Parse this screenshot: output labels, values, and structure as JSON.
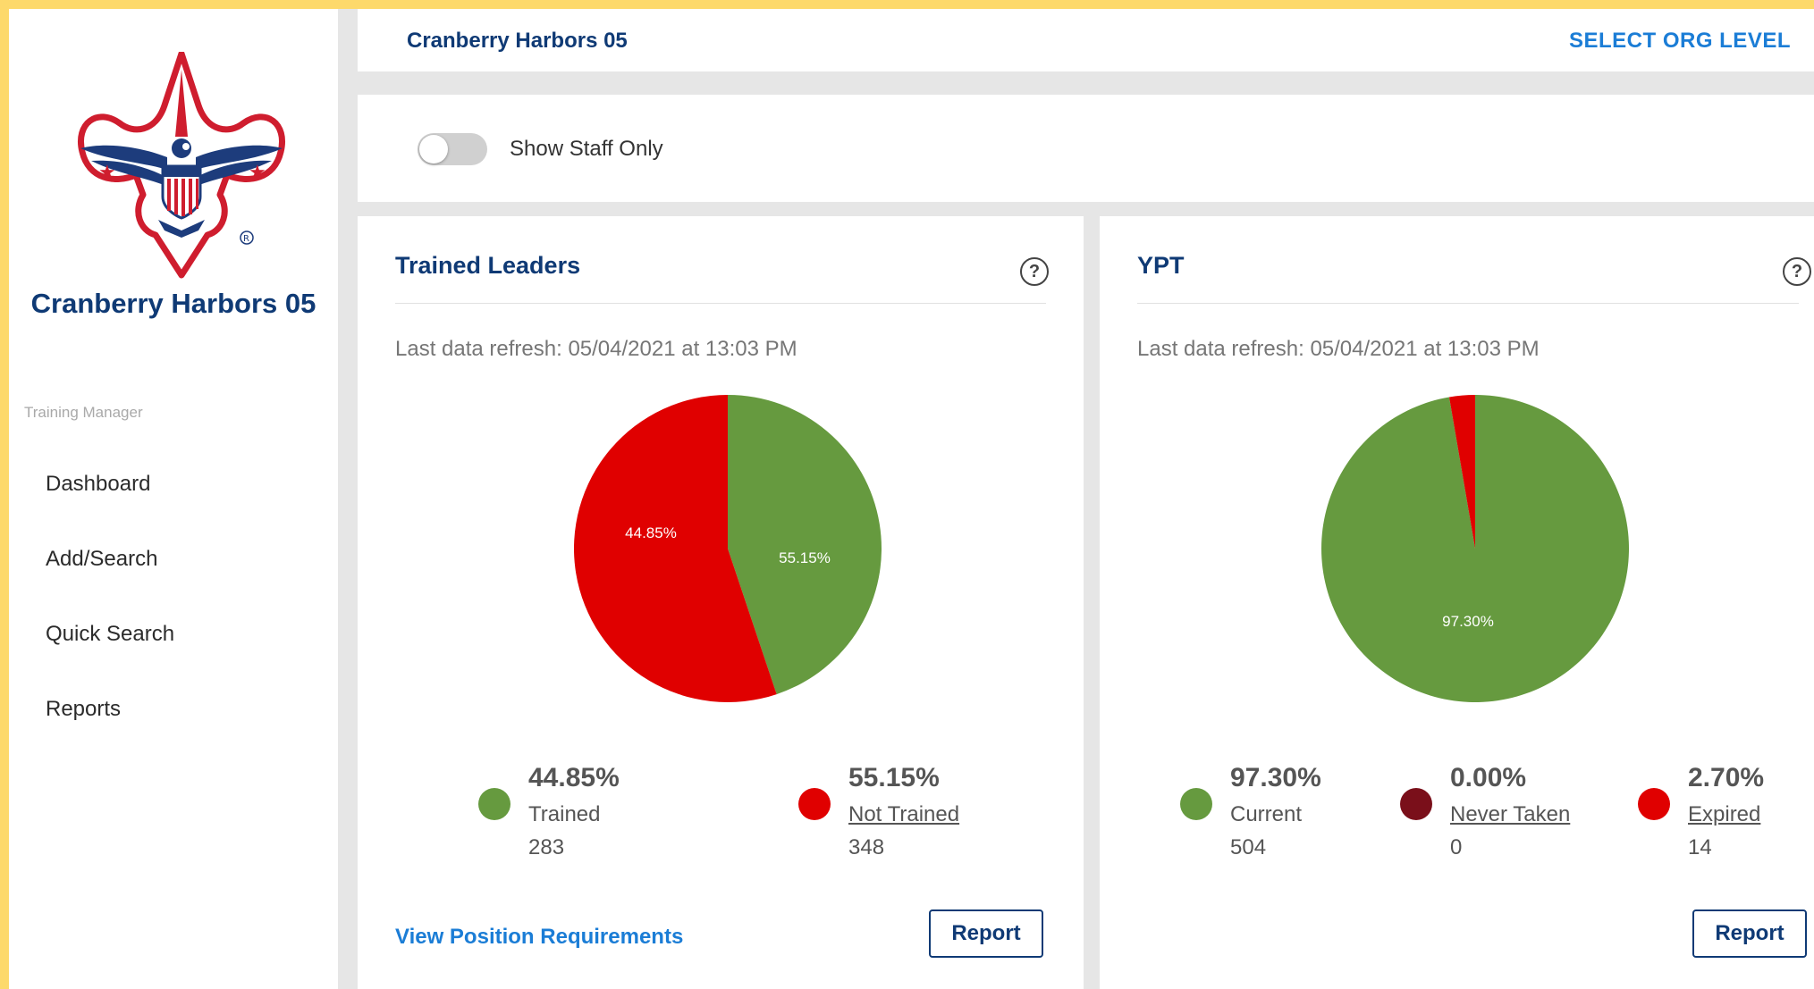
{
  "sidebar": {
    "org_name": "Cranberry Harbors 05",
    "section_label": "Training Manager",
    "items": [
      {
        "label": "Dashboard"
      },
      {
        "label": "Add/Search"
      },
      {
        "label": "Quick Search"
      },
      {
        "label": "Reports"
      }
    ]
  },
  "header": {
    "title": "Cranberry Harbors 05",
    "org_level_label": "SELECT ORG LEVEL"
  },
  "filter": {
    "toggle_label": "Show Staff Only",
    "toggle_on": false
  },
  "colors": {
    "green": "#669a3f",
    "red": "#e00000",
    "dark_red": "#7a0f1a",
    "navy": "#0f3a75",
    "link_blue": "#1b7dd6"
  },
  "trained_leaders": {
    "title": "Trained Leaders",
    "refresh": "Last data refresh: 05/04/2021 at 13:03 PM",
    "legend": [
      {
        "pct": "44.85%",
        "label": "Trained",
        "count": "283",
        "color": "#669a3f"
      },
      {
        "pct": "55.15%",
        "label": "Not Trained",
        "count": "348",
        "color": "#e00000"
      }
    ],
    "link_label": "View Position Requirements",
    "report_label": "Report"
  },
  "ypt": {
    "title": "YPT",
    "refresh": "Last data refresh: 05/04/2021 at 13:03 PM",
    "legend": [
      {
        "pct": "97.30%",
        "label": "Current",
        "count": "504",
        "color": "#669a3f"
      },
      {
        "pct": "0.00%",
        "label": "Never Taken",
        "count": "0",
        "color": "#7a0f1a"
      },
      {
        "pct": "2.70%",
        "label": "Expired",
        "count": "14",
        "color": "#e00000"
      }
    ],
    "report_label": "Report"
  },
  "chart_data": [
    {
      "type": "pie",
      "title": "Trained Leaders",
      "slices": [
        {
          "label": "Trained",
          "value": 44.85,
          "display": "44.85%",
          "color": "#669a3f"
        },
        {
          "label": "Not Trained",
          "value": 55.15,
          "display": "55.15%",
          "color": "#e00000"
        }
      ]
    },
    {
      "type": "pie",
      "title": "YPT",
      "slices": [
        {
          "label": "Current",
          "value": 97.3,
          "display": "97.30%",
          "color": "#669a3f"
        },
        {
          "label": "Never Taken",
          "value": 0.0,
          "display": "",
          "color": "#7a0f1a"
        },
        {
          "label": "Expired",
          "value": 2.7,
          "display": "",
          "color": "#e00000"
        }
      ]
    }
  ]
}
